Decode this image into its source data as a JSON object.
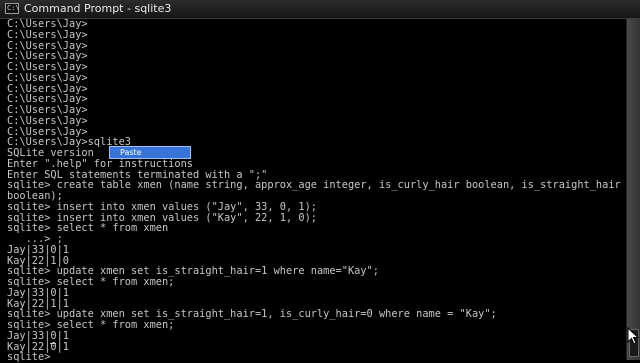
{
  "window": {
    "title": "Command Prompt - sqlite3"
  },
  "icons": {
    "app": "command-prompt-icon",
    "pointer": "mouse-pointer-icon"
  },
  "colors": {
    "console_bg": "#000000",
    "console_fg": "#c6c6c6",
    "menu_highlight": "#3874d8"
  },
  "console": {
    "lines": [
      "C:\\Users\\Jay>",
      "C:\\Users\\Jay>",
      "C:\\Users\\Jay>",
      "C:\\Users\\Jay>",
      "C:\\Users\\Jay>",
      "C:\\Users\\Jay>",
      "C:\\Users\\Jay>",
      "C:\\Users\\Jay>",
      "C:\\Users\\Jay>",
      "C:\\Users\\Jay>",
      "C:\\Users\\Jay>",
      "C:\\Users\\Jay>sqlite3",
      "SQLite version",
      "Enter \".help\" for instructions",
      "Enter SQL statements terminated with a \";\"",
      "sqlite> create table xmen (name string, approx_age integer, is_curly_hair boolean, is_straight_hair",
      "boolean);",
      "sqlite> insert into xmen values (\"Jay\", 33, 0, 1);",
      "sqlite> insert into xmen values (\"Kay\", 22, 1, 0);",
      "sqlite> select * from xmen",
      "   ...> ;",
      "Jay|33|0|1",
      "Kay|22|1|0",
      "sqlite> update xmen set is_straight_hair=1 where name=\"Kay\";",
      "sqlite> select * from xmen;",
      "Jay|33|0|1",
      "Kay|22|1|1",
      "sqlite> update xmen set is_straight_hair=1, is_curly_hair=0 where name = \"Kay\";",
      "sqlite> select * from xmen;",
      "Jay|33|0|1",
      "Kay|22|0|1",
      "sqlite>"
    ]
  },
  "context_menu": {
    "items": [
      {
        "label": "Paste"
      }
    ]
  }
}
